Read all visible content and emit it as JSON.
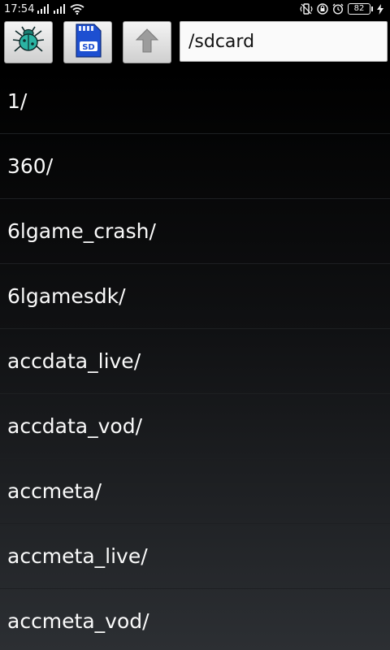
{
  "status_bar": {
    "time": "17:54",
    "battery_level": "82",
    "left_icons": [
      "signal-icon",
      "signal-icon",
      "wifi-icon"
    ],
    "right_icons": [
      "vibrate-icon",
      "lock-rotation-icon",
      "alarm-icon",
      "battery-icon",
      "charging-icon"
    ]
  },
  "toolbar": {
    "buttons": [
      {
        "name": "bug-button",
        "icon": "bug-icon"
      },
      {
        "name": "sdcard-button",
        "icon": "sd-card-icon",
        "icon_text": "SD"
      },
      {
        "name": "up-button",
        "icon": "arrow-up-icon"
      }
    ],
    "path_value": "/sdcard"
  },
  "files": [
    {
      "name": "1/"
    },
    {
      "name": "360/"
    },
    {
      "name": "6lgame_crash/"
    },
    {
      "name": "6lgamesdk/"
    },
    {
      "name": "accdata_live/"
    },
    {
      "name": "accdata_vod/"
    },
    {
      "name": "accmeta/"
    },
    {
      "name": "accmeta_live/"
    },
    {
      "name": "accmeta_vod/"
    }
  ],
  "colors": {
    "accent_bug": "#2bb3a3",
    "sd_blue": "#1d4fd1"
  }
}
